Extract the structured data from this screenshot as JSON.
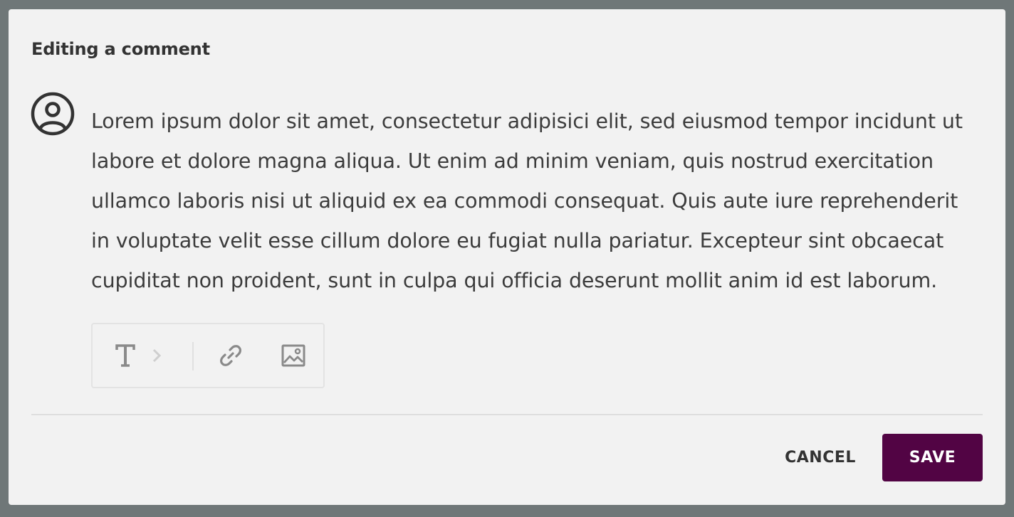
{
  "dialog": {
    "title": "Editing a comment"
  },
  "comment": {
    "avatar_icon": "user-circle-icon",
    "text": "Lorem ipsum dolor sit amet, consectetur adipisici elit, sed eiusmod tempor incidunt ut labore et dolore magna aliqua. Ut enim ad minim veniam, quis nostrud exercitation ullamco laboris nisi ut aliquid ex ea commodi consequat. Quis aute iure reprehenderit in voluptate velit esse cillum dolore eu fugiat nulla pariatur. Excepteur sint obcaecat cupiditat non proident, sunt in culpa qui officia deserunt mollit anim id est laborum."
  },
  "toolbar": {
    "items": [
      {
        "icon": "text-format-icon"
      },
      {
        "icon": "chevron-right-icon"
      },
      {
        "icon": "link-icon"
      },
      {
        "icon": "image-icon"
      }
    ]
  },
  "actions": {
    "cancel_label": "CANCEL",
    "save_label": "SAVE"
  },
  "colors": {
    "backdrop": "#6f7778",
    "dialog_bg": "#f2f2f2",
    "text": "#3c3c3c",
    "primary": "#520444",
    "icon_muted": "#8a8a8a"
  }
}
